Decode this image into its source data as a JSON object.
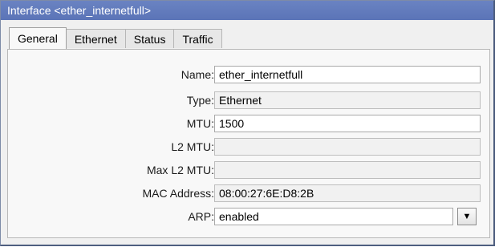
{
  "window": {
    "title": "Interface <ether_internetfull>"
  },
  "tabs": [
    {
      "label": "General",
      "active": true
    },
    {
      "label": "Ethernet",
      "active": false
    },
    {
      "label": "Status",
      "active": false
    },
    {
      "label": "Traffic",
      "active": false
    }
  ],
  "form": {
    "name": {
      "label": "Name:",
      "value": "ether_internetfull"
    },
    "type": {
      "label": "Type:",
      "value": "Ethernet"
    },
    "mtu": {
      "label": "MTU:",
      "value": "1500"
    },
    "l2mtu": {
      "label": "L2 MTU:",
      "value": ""
    },
    "max_l2mtu": {
      "label": "Max L2 MTU:",
      "value": ""
    },
    "mac": {
      "label": "MAC Address:",
      "value": "08:00:27:6E:D8:2B"
    },
    "arp": {
      "label": "ARP:",
      "value": "enabled",
      "dropdown_icon": "arrow-down-icon"
    }
  },
  "colors": {
    "titlebar": "#5b74b7",
    "panel": "#f8f8f8"
  }
}
